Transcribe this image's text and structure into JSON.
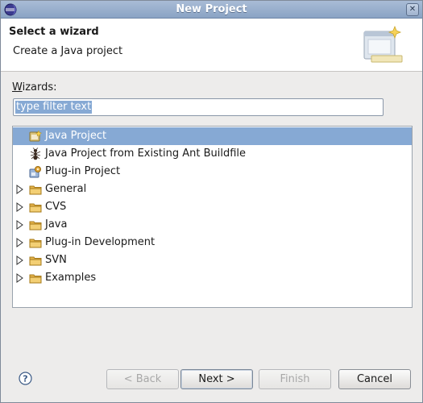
{
  "window": {
    "title": "New Project",
    "app_icon": "eclipse-icon",
    "close_icon": "close-icon"
  },
  "banner": {
    "heading": "Select a wizard",
    "description": "Create a Java project",
    "icon": "new-project-wizard-icon"
  },
  "wizards": {
    "label_mnemonic": "W",
    "label_rest": "izards:",
    "filter_placeholder": "type filter text",
    "filter_value": "type filter text"
  },
  "tree": {
    "items": [
      {
        "label": "Java Project",
        "icon": "java-project-icon",
        "expandable": false,
        "selected": true
      },
      {
        "label": "Java Project from Existing Ant Buildfile",
        "icon": "ant-icon",
        "expandable": false,
        "selected": false
      },
      {
        "label": "Plug-in Project",
        "icon": "plugin-project-icon",
        "expandable": false,
        "selected": false
      },
      {
        "label": "General",
        "icon": "folder-icon",
        "expandable": true,
        "selected": false
      },
      {
        "label": "CVS",
        "icon": "folder-icon",
        "expandable": true,
        "selected": false
      },
      {
        "label": "Java",
        "icon": "folder-icon",
        "expandable": true,
        "selected": false
      },
      {
        "label": "Plug-in Development",
        "icon": "folder-icon",
        "expandable": true,
        "selected": false
      },
      {
        "label": "SVN",
        "icon": "folder-icon",
        "expandable": true,
        "selected": false
      },
      {
        "label": "Examples",
        "icon": "folder-icon",
        "expandable": true,
        "selected": false
      }
    ]
  },
  "buttons": {
    "help_icon": "help-icon",
    "back": "< Back",
    "next": "Next >",
    "finish": "Finish",
    "cancel": "Cancel"
  },
  "colors": {
    "selection": "#86a9d4",
    "titlebar": "#8aa3c4",
    "folder": "#e8b64c"
  }
}
